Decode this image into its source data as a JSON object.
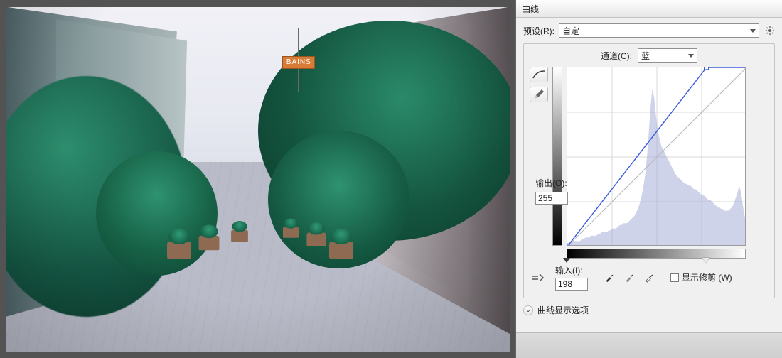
{
  "photo_sign": "BAINS",
  "panel": {
    "title": "曲线",
    "preset_label": "预设(R):",
    "preset_value": "自定",
    "channel_label": "通道(C):",
    "channel_value": "蓝",
    "output_label": "输出(O):",
    "output_value": "255",
    "input_label": "输入(I):",
    "input_value": "198",
    "show_clipping_label": "显示修剪 (W)",
    "disclosure_label": "曲线显示选项",
    "hotkeys": {
      "preset": "R",
      "channel": "C",
      "output": "O",
      "input": "I",
      "clip": "W"
    }
  },
  "curve": {
    "size": 252,
    "black_slider": 0,
    "white_slider": 198,
    "points": [
      {
        "in": 0,
        "out": 0
      },
      {
        "in": 198,
        "out": 255
      }
    ],
    "histogram": [
      0.02,
      0.02,
      0.02,
      0.03,
      0.03,
      0.03,
      0.03,
      0.03,
      0.04,
      0.04,
      0.05,
      0.05,
      0.05,
      0.06,
      0.06,
      0.06,
      0.06,
      0.07,
      0.07,
      0.08,
      0.08,
      0.08,
      0.08,
      0.09,
      0.09,
      0.1,
      0.1,
      0.1,
      0.11,
      0.12,
      0.12,
      0.13,
      0.13,
      0.13,
      0.14,
      0.15,
      0.16,
      0.17,
      0.19,
      0.21,
      0.24,
      0.28,
      0.33,
      0.4,
      0.5,
      0.63,
      0.78,
      0.88,
      0.83,
      0.73,
      0.65,
      0.6,
      0.56,
      0.54,
      0.52,
      0.5,
      0.48,
      0.46,
      0.44,
      0.42,
      0.4,
      0.39,
      0.38,
      0.37,
      0.36,
      0.35,
      0.35,
      0.34,
      0.34,
      0.33,
      0.32,
      0.32,
      0.31,
      0.3,
      0.29,
      0.29,
      0.28,
      0.27,
      0.26,
      0.26,
      0.25,
      0.24,
      0.23,
      0.22,
      0.22,
      0.21,
      0.21,
      0.2,
      0.2,
      0.2,
      0.21,
      0.22,
      0.24,
      0.27,
      0.3,
      0.34,
      0.3,
      0.23,
      0.17,
      0.12
    ]
  }
}
